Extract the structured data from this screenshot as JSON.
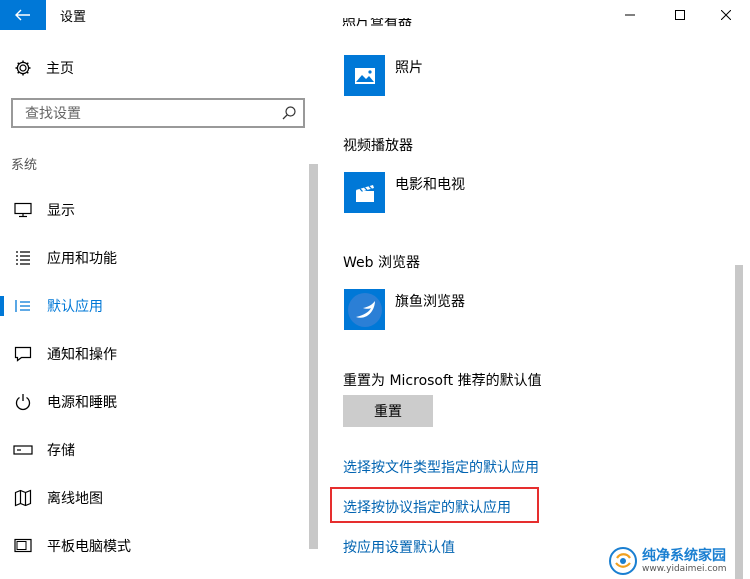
{
  "window": {
    "title": "设置",
    "back_icon": "back-arrow-icon",
    "minimize_icon": "minimize-icon",
    "maximize_icon": "maximize-icon",
    "close_icon": "close-icon"
  },
  "sidebar": {
    "home_label": "主页",
    "search_placeholder": "查找设置",
    "section_label": "系统",
    "items": [
      {
        "label": "显示",
        "icon": "monitor-icon"
      },
      {
        "label": "应用和功能",
        "icon": "list-icon"
      },
      {
        "label": "默认应用",
        "icon": "default-apps-icon",
        "active": true
      },
      {
        "label": "通知和操作",
        "icon": "notification-icon"
      },
      {
        "label": "电源和睡眠",
        "icon": "power-icon"
      },
      {
        "label": "存储",
        "icon": "storage-icon"
      },
      {
        "label": "离线地图",
        "icon": "map-icon"
      },
      {
        "label": "平板电脑模式",
        "icon": "tablet-icon"
      }
    ]
  },
  "main": {
    "cut_heading": "照片查看器",
    "photo_app": "照片",
    "video_heading": "视频播放器",
    "video_app": "电影和电视",
    "browser_heading": "Web 浏览器",
    "browser_app": "旗鱼浏览器",
    "reset_heading": "重置为 Microsoft 推荐的默认值",
    "reset_button": "重置",
    "link_filetype": "选择按文件类型指定的默认应用",
    "link_protocol": "选择按协议指定的默认应用",
    "link_app": "按应用设置默认值"
  },
  "watermark": {
    "title": "纯净系统家园",
    "url": "www.yidaimei.com"
  },
  "colors": {
    "accent": "#0078d7",
    "link": "#0063b1",
    "highlight": "#e62e2e"
  }
}
